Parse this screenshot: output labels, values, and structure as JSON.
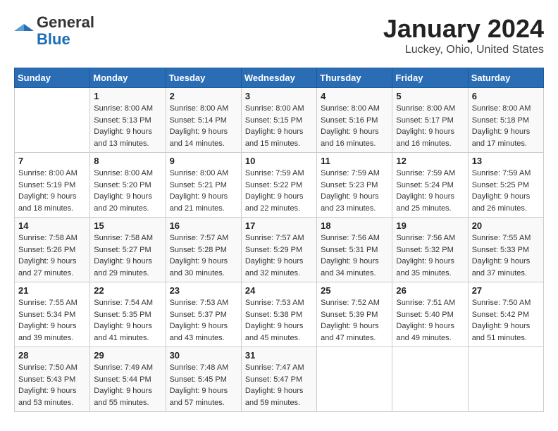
{
  "header": {
    "logo_general": "General",
    "logo_blue": "Blue",
    "title": "January 2024",
    "subtitle": "Luckey, Ohio, United States"
  },
  "weekdays": [
    "Sunday",
    "Monday",
    "Tuesday",
    "Wednesday",
    "Thursday",
    "Friday",
    "Saturday"
  ],
  "weeks": [
    [
      {
        "day": "",
        "sunrise": "",
        "sunset": "",
        "daylight": ""
      },
      {
        "day": "1",
        "sunrise": "Sunrise: 8:00 AM",
        "sunset": "Sunset: 5:13 PM",
        "daylight": "Daylight: 9 hours and 13 minutes."
      },
      {
        "day": "2",
        "sunrise": "Sunrise: 8:00 AM",
        "sunset": "Sunset: 5:14 PM",
        "daylight": "Daylight: 9 hours and 14 minutes."
      },
      {
        "day": "3",
        "sunrise": "Sunrise: 8:00 AM",
        "sunset": "Sunset: 5:15 PM",
        "daylight": "Daylight: 9 hours and 15 minutes."
      },
      {
        "day": "4",
        "sunrise": "Sunrise: 8:00 AM",
        "sunset": "Sunset: 5:16 PM",
        "daylight": "Daylight: 9 hours and 16 minutes."
      },
      {
        "day": "5",
        "sunrise": "Sunrise: 8:00 AM",
        "sunset": "Sunset: 5:17 PM",
        "daylight": "Daylight: 9 hours and 16 minutes."
      },
      {
        "day": "6",
        "sunrise": "Sunrise: 8:00 AM",
        "sunset": "Sunset: 5:18 PM",
        "daylight": "Daylight: 9 hours and 17 minutes."
      }
    ],
    [
      {
        "day": "7",
        "sunrise": "Sunrise: 8:00 AM",
        "sunset": "Sunset: 5:19 PM",
        "daylight": "Daylight: 9 hours and 18 minutes."
      },
      {
        "day": "8",
        "sunrise": "Sunrise: 8:00 AM",
        "sunset": "Sunset: 5:20 PM",
        "daylight": "Daylight: 9 hours and 20 minutes."
      },
      {
        "day": "9",
        "sunrise": "Sunrise: 8:00 AM",
        "sunset": "Sunset: 5:21 PM",
        "daylight": "Daylight: 9 hours and 21 minutes."
      },
      {
        "day": "10",
        "sunrise": "Sunrise: 7:59 AM",
        "sunset": "Sunset: 5:22 PM",
        "daylight": "Daylight: 9 hours and 22 minutes."
      },
      {
        "day": "11",
        "sunrise": "Sunrise: 7:59 AM",
        "sunset": "Sunset: 5:23 PM",
        "daylight": "Daylight: 9 hours and 23 minutes."
      },
      {
        "day": "12",
        "sunrise": "Sunrise: 7:59 AM",
        "sunset": "Sunset: 5:24 PM",
        "daylight": "Daylight: 9 hours and 25 minutes."
      },
      {
        "day": "13",
        "sunrise": "Sunrise: 7:59 AM",
        "sunset": "Sunset: 5:25 PM",
        "daylight": "Daylight: 9 hours and 26 minutes."
      }
    ],
    [
      {
        "day": "14",
        "sunrise": "Sunrise: 7:58 AM",
        "sunset": "Sunset: 5:26 PM",
        "daylight": "Daylight: 9 hours and 27 minutes."
      },
      {
        "day": "15",
        "sunrise": "Sunrise: 7:58 AM",
        "sunset": "Sunset: 5:27 PM",
        "daylight": "Daylight: 9 hours and 29 minutes."
      },
      {
        "day": "16",
        "sunrise": "Sunrise: 7:57 AM",
        "sunset": "Sunset: 5:28 PM",
        "daylight": "Daylight: 9 hours and 30 minutes."
      },
      {
        "day": "17",
        "sunrise": "Sunrise: 7:57 AM",
        "sunset": "Sunset: 5:29 PM",
        "daylight": "Daylight: 9 hours and 32 minutes."
      },
      {
        "day": "18",
        "sunrise": "Sunrise: 7:56 AM",
        "sunset": "Sunset: 5:31 PM",
        "daylight": "Daylight: 9 hours and 34 minutes."
      },
      {
        "day": "19",
        "sunrise": "Sunrise: 7:56 AM",
        "sunset": "Sunset: 5:32 PM",
        "daylight": "Daylight: 9 hours and 35 minutes."
      },
      {
        "day": "20",
        "sunrise": "Sunrise: 7:55 AM",
        "sunset": "Sunset: 5:33 PM",
        "daylight": "Daylight: 9 hours and 37 minutes."
      }
    ],
    [
      {
        "day": "21",
        "sunrise": "Sunrise: 7:55 AM",
        "sunset": "Sunset: 5:34 PM",
        "daylight": "Daylight: 9 hours and 39 minutes."
      },
      {
        "day": "22",
        "sunrise": "Sunrise: 7:54 AM",
        "sunset": "Sunset: 5:35 PM",
        "daylight": "Daylight: 9 hours and 41 minutes."
      },
      {
        "day": "23",
        "sunrise": "Sunrise: 7:53 AM",
        "sunset": "Sunset: 5:37 PM",
        "daylight": "Daylight: 9 hours and 43 minutes."
      },
      {
        "day": "24",
        "sunrise": "Sunrise: 7:53 AM",
        "sunset": "Sunset: 5:38 PM",
        "daylight": "Daylight: 9 hours and 45 minutes."
      },
      {
        "day": "25",
        "sunrise": "Sunrise: 7:52 AM",
        "sunset": "Sunset: 5:39 PM",
        "daylight": "Daylight: 9 hours and 47 minutes."
      },
      {
        "day": "26",
        "sunrise": "Sunrise: 7:51 AM",
        "sunset": "Sunset: 5:40 PM",
        "daylight": "Daylight: 9 hours and 49 minutes."
      },
      {
        "day": "27",
        "sunrise": "Sunrise: 7:50 AM",
        "sunset": "Sunset: 5:42 PM",
        "daylight": "Daylight: 9 hours and 51 minutes."
      }
    ],
    [
      {
        "day": "28",
        "sunrise": "Sunrise: 7:50 AM",
        "sunset": "Sunset: 5:43 PM",
        "daylight": "Daylight: 9 hours and 53 minutes."
      },
      {
        "day": "29",
        "sunrise": "Sunrise: 7:49 AM",
        "sunset": "Sunset: 5:44 PM",
        "daylight": "Daylight: 9 hours and 55 minutes."
      },
      {
        "day": "30",
        "sunrise": "Sunrise: 7:48 AM",
        "sunset": "Sunset: 5:45 PM",
        "daylight": "Daylight: 9 hours and 57 minutes."
      },
      {
        "day": "31",
        "sunrise": "Sunrise: 7:47 AM",
        "sunset": "Sunset: 5:47 PM",
        "daylight": "Daylight: 9 hours and 59 minutes."
      },
      {
        "day": "",
        "sunrise": "",
        "sunset": "",
        "daylight": ""
      },
      {
        "day": "",
        "sunrise": "",
        "sunset": "",
        "daylight": ""
      },
      {
        "day": "",
        "sunrise": "",
        "sunset": "",
        "daylight": ""
      }
    ]
  ]
}
